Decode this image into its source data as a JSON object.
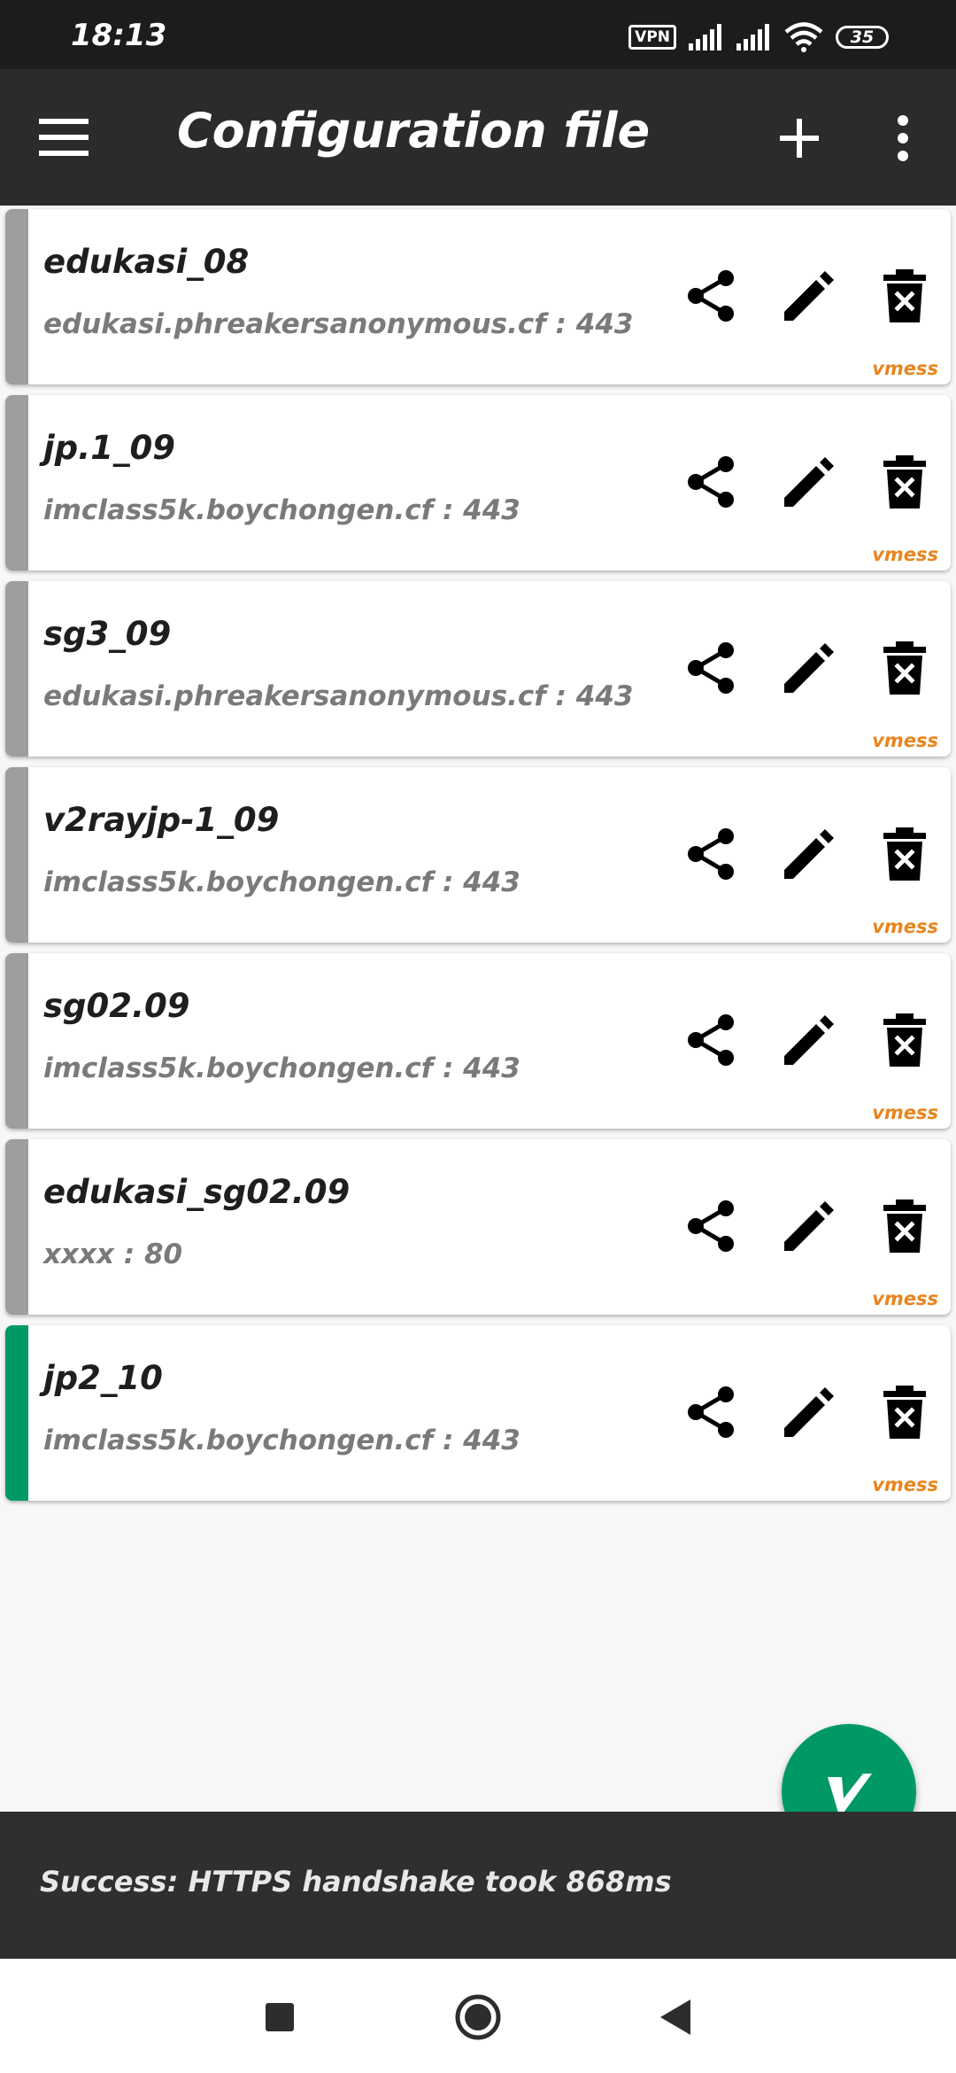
{
  "status_bar": {
    "time": "18:13",
    "vpn_label": "VPN",
    "battery": "35",
    "icons": [
      "vpn-icon",
      "signal-icon",
      "signal-icon",
      "wifi-icon",
      "battery-icon"
    ]
  },
  "toolbar": {
    "title": "Configuration file",
    "menu_icon": "menu-icon",
    "add_icon": "add-icon",
    "more_icon": "more-vert-icon"
  },
  "servers": [
    {
      "name": "edukasi_08",
      "address": "edukasi.phreakersanonymous.cf : 443",
      "type": "vmess",
      "selected": false
    },
    {
      "name": "jp.1_09",
      "address": "imclass5k.boychongen.cf : 443",
      "type": "vmess",
      "selected": false
    },
    {
      "name": "sg3_09",
      "address": "edukasi.phreakersanonymous.cf : 443",
      "type": "vmess",
      "selected": false
    },
    {
      "name": "v2rayjp-1_09",
      "address": "imclass5k.boychongen.cf : 443",
      "type": "vmess",
      "selected": false
    },
    {
      "name": "sg02.09",
      "address": "imclass5k.boychongen.cf : 443",
      "type": "vmess",
      "selected": false
    },
    {
      "name": "edukasi_sg02.09",
      "address": "xxxx : 80",
      "type": "vmess",
      "selected": false
    },
    {
      "name": "jp2_10",
      "address": "imclass5k.boychongen.cf : 443",
      "type": "vmess",
      "selected": true
    }
  ],
  "actions": {
    "share_icon": "share-icon",
    "edit_icon": "edit-icon",
    "delete_icon": "delete-icon"
  },
  "snackbar": {
    "message": "Success: HTTPS handshake took 868ms"
  },
  "fab": {
    "icon": "v2ray-connect-icon"
  },
  "navbar": {
    "buttons": [
      "recents-button",
      "home-button",
      "back-button"
    ]
  },
  "colors": {
    "toolbar": "#2b2b2b",
    "selected_stripe": "#009966",
    "unselected_stripe": "#9e9e9e",
    "type_label": "#e8851e",
    "fab": "#009966"
  }
}
